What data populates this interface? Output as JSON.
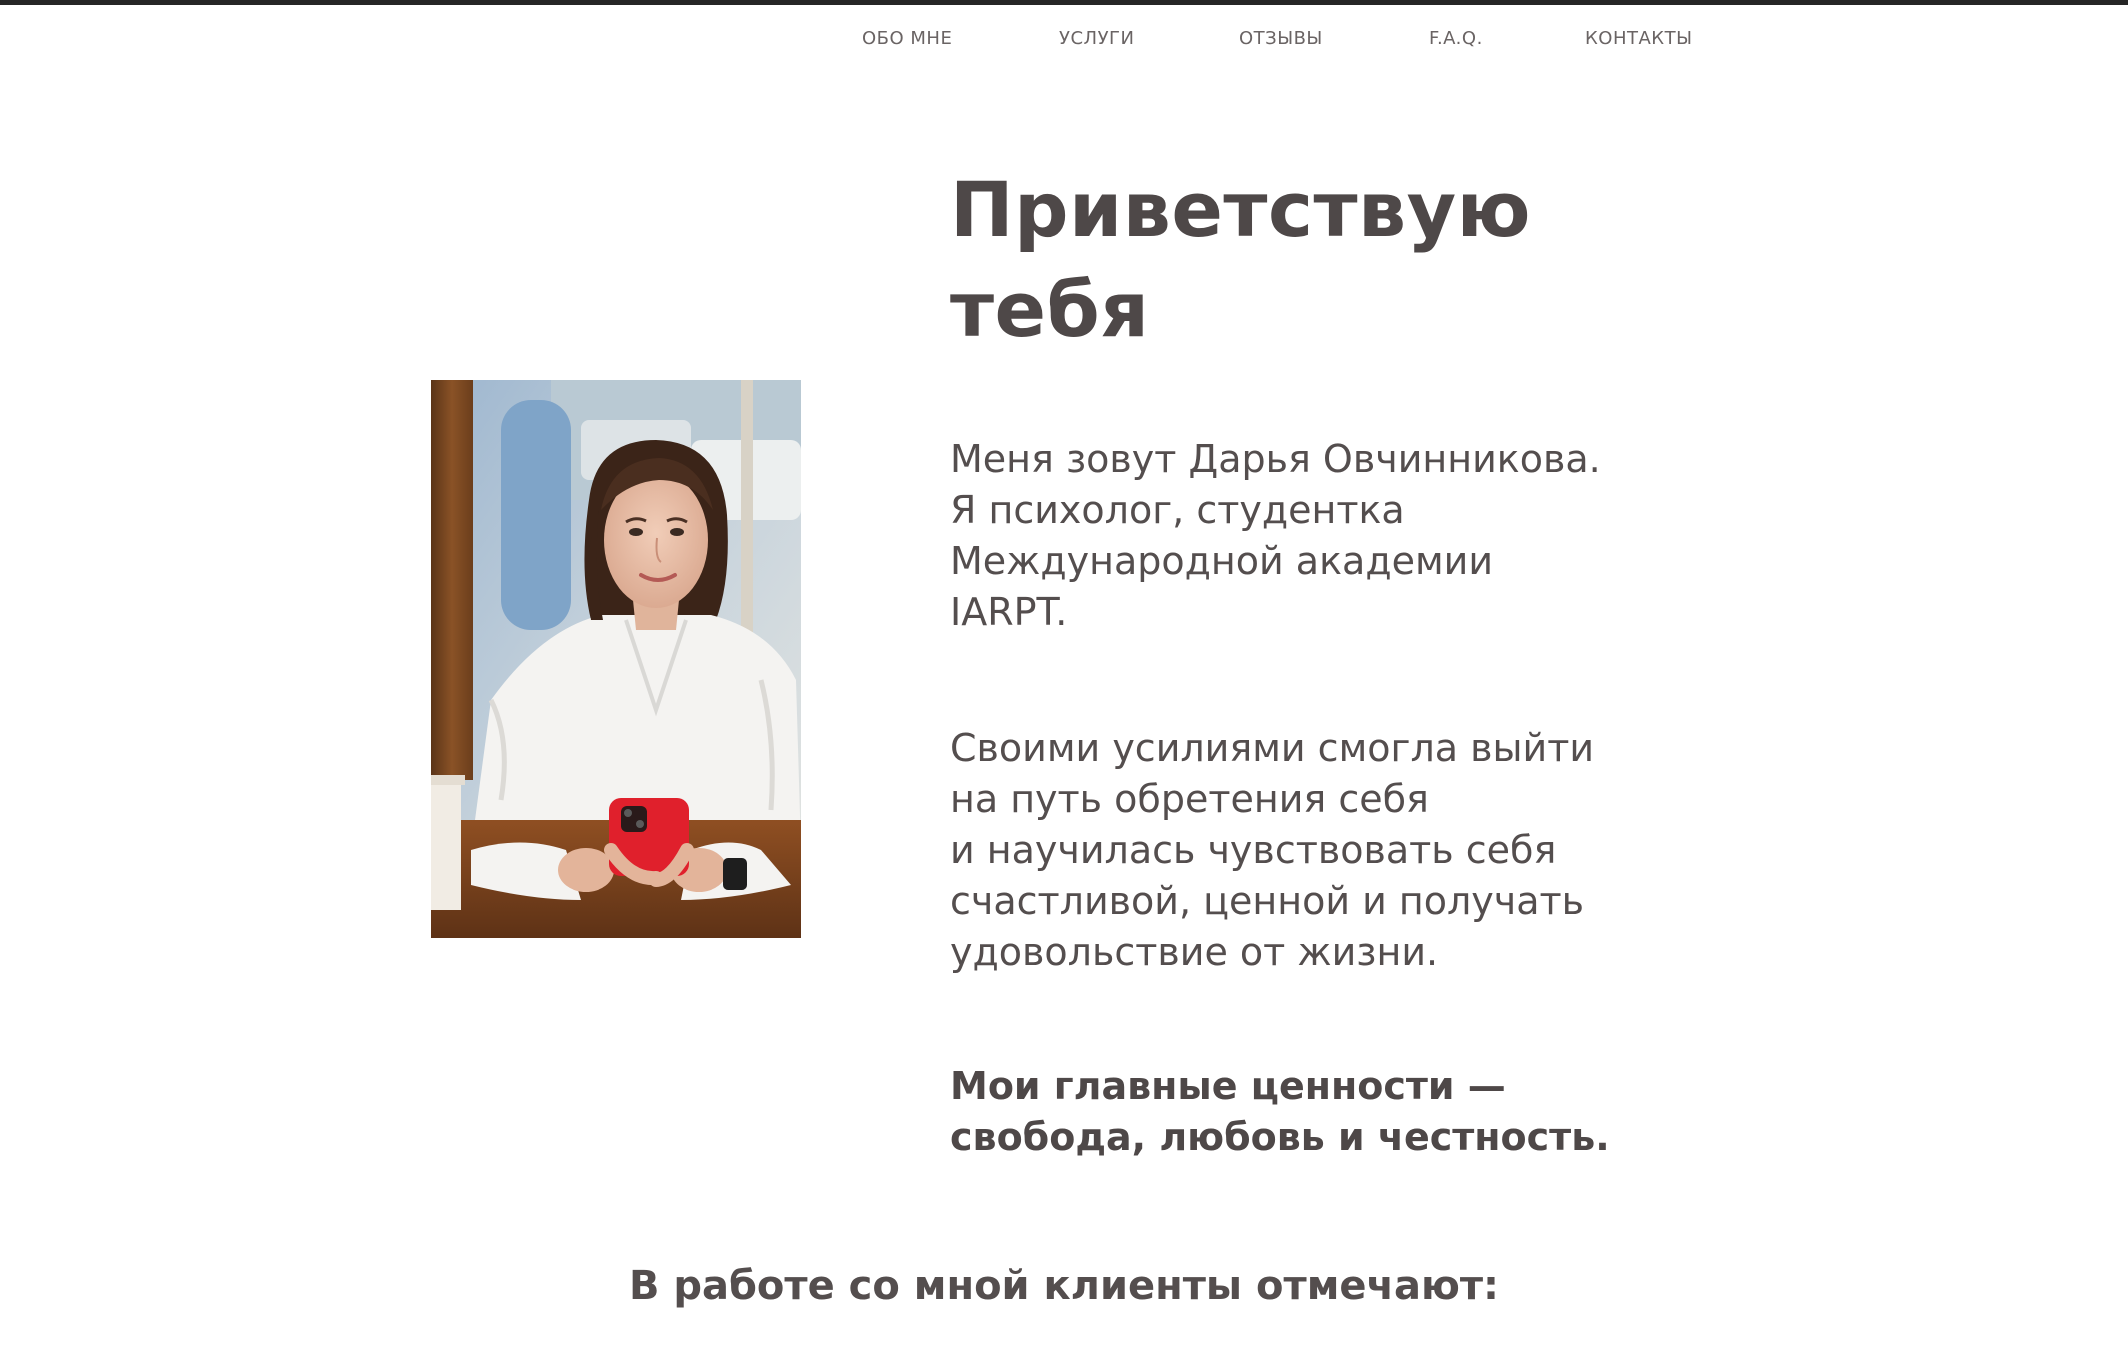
{
  "nav": {
    "items": [
      {
        "label": "ОБО МНЕ"
      },
      {
        "label": "УСЛУГИ"
      },
      {
        "label": "ОТЗЫВЫ"
      },
      {
        "label": "F.A.Q."
      },
      {
        "label": "КОНТАКТЫ"
      }
    ]
  },
  "hero": {
    "title_lines": [
      "Приветствую",
      "тебя"
    ],
    "photo_icon": "portrait-photo"
  },
  "about": {
    "intro_lines": [
      "Меня зовут Дарья Овчинникова.",
      "Я психолог, студентка",
      "Международной академии",
      "IARPT."
    ],
    "journey_lines": [
      "Своими усилиями смогла выйти",
      "на путь обретения себя",
      "и научилась чувствовать себя",
      "счастливой, ценной и получать",
      "удовольствие от жизни."
    ],
    "values_lines": [
      "Мои главные ценности —",
      "свобода, любовь и честность."
    ]
  },
  "clients": {
    "heading": "В работе со мной клиенты отмечают:"
  },
  "colors": {
    "text": "#4e4848",
    "nav_text": "#6a6464",
    "top_bar": "#262626",
    "background": "#ffffff"
  }
}
